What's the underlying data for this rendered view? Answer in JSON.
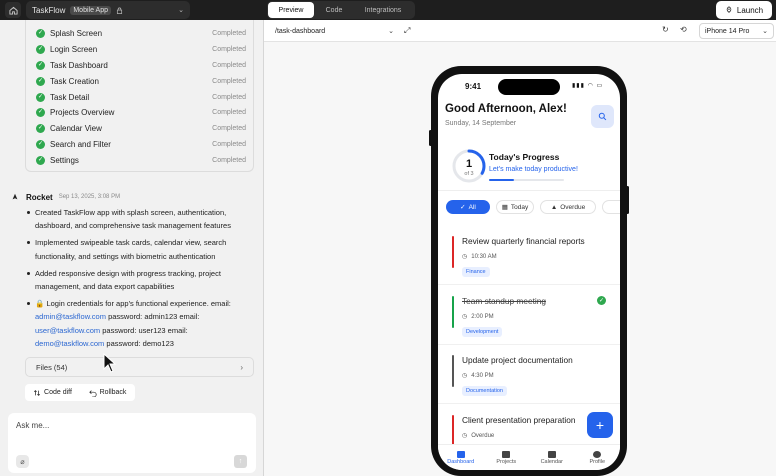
{
  "topbar": {
    "project_name": "TaskFlow",
    "project_badge": "Mobile App",
    "tabs": [
      "Preview",
      "Code",
      "Integrations"
    ],
    "launch_label": "Launch"
  },
  "tasks": [
    {
      "name": "Splash Screen",
      "status": "Completed"
    },
    {
      "name": "Login Screen",
      "status": "Completed"
    },
    {
      "name": "Task Dashboard",
      "status": "Completed"
    },
    {
      "name": "Task Creation",
      "status": "Completed"
    },
    {
      "name": "Task Detail",
      "status": "Completed"
    },
    {
      "name": "Projects Overview",
      "status": "Completed"
    },
    {
      "name": "Calendar View",
      "status": "Completed"
    },
    {
      "name": "Search and Filter",
      "status": "Completed"
    },
    {
      "name": "Settings",
      "status": "Completed"
    }
  ],
  "chat": {
    "author": "Rocket",
    "date": "Sep 13, 2025, 3:08 PM",
    "bullets": [
      "Created TaskFlow app with splash screen, authentication, dashboard, and comprehensive task management features",
      "Implemented swipeable task cards, calendar view, search functionality, and settings with biometric authentication",
      "Added responsive design with progress tracking, project management, and data export capabilities"
    ],
    "creds_intro": "Login credentials for app's functional experience. email:",
    "cred1_email": "admin@taskflow.com",
    "cred1_rest": "password: admin123 email:",
    "cred2_email": "user@taskflow.com",
    "cred2_rest": "password: user123 email:",
    "cred3_email": "demo@taskflow.com",
    "cred3_rest": "password: demo123",
    "files_label": "Files (54)",
    "code_diff_label": "Code diff",
    "rollback_label": "Rollback",
    "ask_placeholder": "Ask me..."
  },
  "preview": {
    "route": "/task-dashboard",
    "device": "iPhone 14 Pro"
  },
  "app": {
    "time": "9:41",
    "greeting": "Good Afternoon, Alex!",
    "date": "Sunday, 14 September",
    "progress_num": "1",
    "progress_of": "of 3",
    "progress_fraction": 0.33,
    "progress_title": "Today's Progress",
    "progress_sub": "Let's make today productive!",
    "chips": [
      "All",
      "Today",
      "Overdue"
    ],
    "tasks": [
      {
        "title": "Review quarterly financial reports",
        "time": "10:30 AM",
        "tag": "Finance",
        "color": "#dc2626",
        "done": false
      },
      {
        "title": "Team standup meeting",
        "time": "2:00 PM",
        "tag": "Development",
        "color": "#16a34a",
        "done": true
      },
      {
        "title": "Update project documentation",
        "time": "4:30 PM",
        "tag": "Documentation",
        "color": "#555555",
        "done": false
      },
      {
        "title": "Client presentation preparation",
        "time": "Overdue",
        "tag": "",
        "color": "#dc2626",
        "done": false
      }
    ],
    "nav": [
      "Dashboard",
      "Projects",
      "Calendar",
      "Profile"
    ]
  },
  "colors": {
    "accent": "#2563eb",
    "success": "#2fa84f",
    "danger": "#dc2626"
  }
}
